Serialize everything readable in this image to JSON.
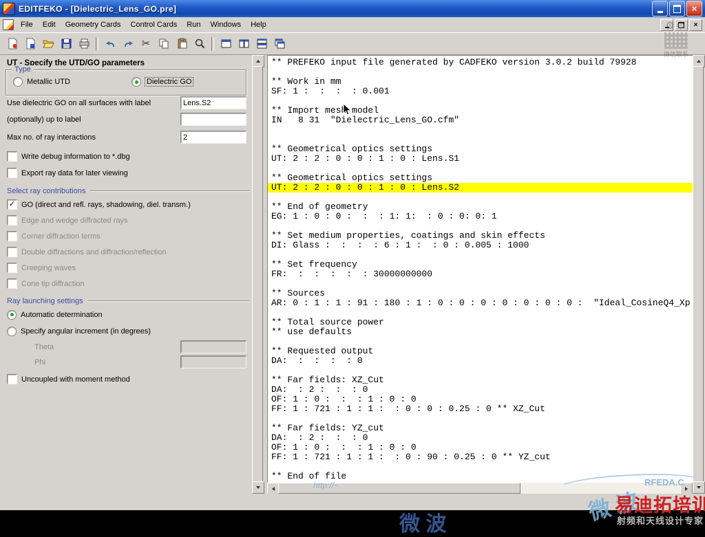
{
  "window": {
    "title": "EDITFEKO - [Dielectric_Lens_GO.pre]",
    "control_icons": [
      "minimize-icon",
      "maximize-icon",
      "close-icon"
    ]
  },
  "menubar": {
    "items": [
      "File",
      "Edit",
      "Geometry Cards",
      "Control Cards",
      "Run",
      "Windows",
      "Help"
    ],
    "mdi_control_icons": [
      "minimize-icon",
      "restore-icon",
      "close-icon"
    ]
  },
  "toolbar": {
    "icons": [
      "new-pre-file-icon",
      "new-file-icon",
      "open-folder-icon",
      "save-icon",
      "print-icon",
      "undo-icon",
      "redo-icon",
      "cut-icon",
      "copy-icon",
      "paste-icon",
      "search-icon",
      "new-window-icon",
      "tile-vertical-icon",
      "tile-horizontal-icon",
      "cascade-icon"
    ]
  },
  "glyphs": {
    "check": "✓",
    "close": "×",
    "scissors": "✂",
    "gear": "⚙⚙"
  },
  "panel": {
    "header": "UT - Specify the UTD/GO parameters",
    "type_group": {
      "label": "Type",
      "options": [
        {
          "label": "Metallic UTD",
          "selected": false
        },
        {
          "label": "Dielectric GO",
          "selected": true
        }
      ]
    },
    "surfaces_label": "Use dielectric GO on all surfaces with label",
    "surfaces_value": "Lens.S2",
    "up_to_label": "(optionally) up to label",
    "up_to_value": "",
    "max_interactions_label": "Max no. of ray interactions",
    "max_interactions_value": "2",
    "debug_checkbox": "Write debug information to *.dbg",
    "export_checkbox": "Export ray data for later viewing",
    "ray_contributions": {
      "label": "Select ray contributions",
      "items": [
        {
          "label": "GO (direct and refl. rays, shadowing, diel. transm.)",
          "checked": true,
          "enabled": true
        },
        {
          "label": "Edge and wedge diffracted rays",
          "checked": false,
          "enabled": false
        },
        {
          "label": "Corner diffraction terms",
          "checked": false,
          "enabled": false
        },
        {
          "label": "Double diffractions and diffraction/reflection",
          "checked": false,
          "enabled": false
        },
        {
          "label": "Creeping waves",
          "checked": false,
          "enabled": false
        },
        {
          "label": "Cone tip diffraction",
          "checked": false,
          "enabled": false
        }
      ]
    },
    "ray_launching": {
      "label": "Ray launching settings",
      "options": [
        {
          "label": "Automatic determination",
          "selected": true
        },
        {
          "label": "Specify angular increment (in degrees)",
          "selected": false
        }
      ],
      "theta_label": "Theta",
      "theta_value": "",
      "phi_label": "Phi",
      "phi_value": ""
    },
    "uncoupled_checkbox": "Uncoupled with moment method"
  },
  "editor": {
    "highlight_index": 13,
    "highlight_color": "#ffff00",
    "lines": [
      "** PREFEKO input file generated by CADFEKO version 3.0.2 build 79928",
      "",
      "** Work in mm",
      "SF: 1 :  :  :  : 0.001",
      "",
      "** Import mesh model",
      "IN   8 31  \"Dielectric_Lens_GO.cfm\"",
      "",
      "",
      "** Geometrical optics settings",
      "UT: 2 : 2 : 0 : 0 : 1 : 0 : Lens.S1",
      "",
      "** Geometrical optics settings",
      "UT: 2 : 2 : 0 : 0 : 1 : 0 : Lens.S2",
      "",
      "** End of geometry",
      "EG: 1 : 0 : 0 :  :  : 1: 1:  : 0 : 0: 0: 1",
      "",
      "** Set medium properties, coatings and skin effects",
      "DI: Glass :  :  :  : 6 : 1 :  : 0 : 0.005 : 1000",
      "",
      "** Set frequency",
      "FR:  :  :  :  :  : 30000000000",
      "",
      "** Sources",
      "AR: 0 : 1 : 1 : 91 : 180 : 1 : 0 : 0 : 0 : 0 : 0 : 0 : 0 :  \"Ideal_CosineQ4_Xp",
      "",
      "** Total source power",
      "** use defaults",
      "",
      "** Requested output",
      "DA:  :  :  :  : 0",
      "",
      "** Far fields: XZ_Cut",
      "DA:  : 2 :  :  : 0",
      "OF: 1 : 0 :  :  : 1 : 0 : 0",
      "FF: 1 : 721 : 1 : 1 :  : 0 : 0 : 0.25 : 0 ** XZ_Cut",
      "",
      "** Far fields: YZ_cut",
      "DA:  : 2 :  :  : 0",
      "OF: 1 : 0 :  :  : 1 : 0 : 0",
      "FF: 1 : 721 : 1 : 1 :  : 0 : 90 : 0.25 : 0 ** YZ_cut",
      "",
      "** End of file"
    ]
  },
  "watermarks": {
    "wechat_caption": "微信联系",
    "url_text": "http://~",
    "brand_en": "RFEDA.C",
    "microwave": "微 波",
    "microwave2": "微 波",
    "brand_cn": "易迪拓培训",
    "brand_sub": "射频和天线设计专家",
    "brand_color": "#cc2020"
  }
}
